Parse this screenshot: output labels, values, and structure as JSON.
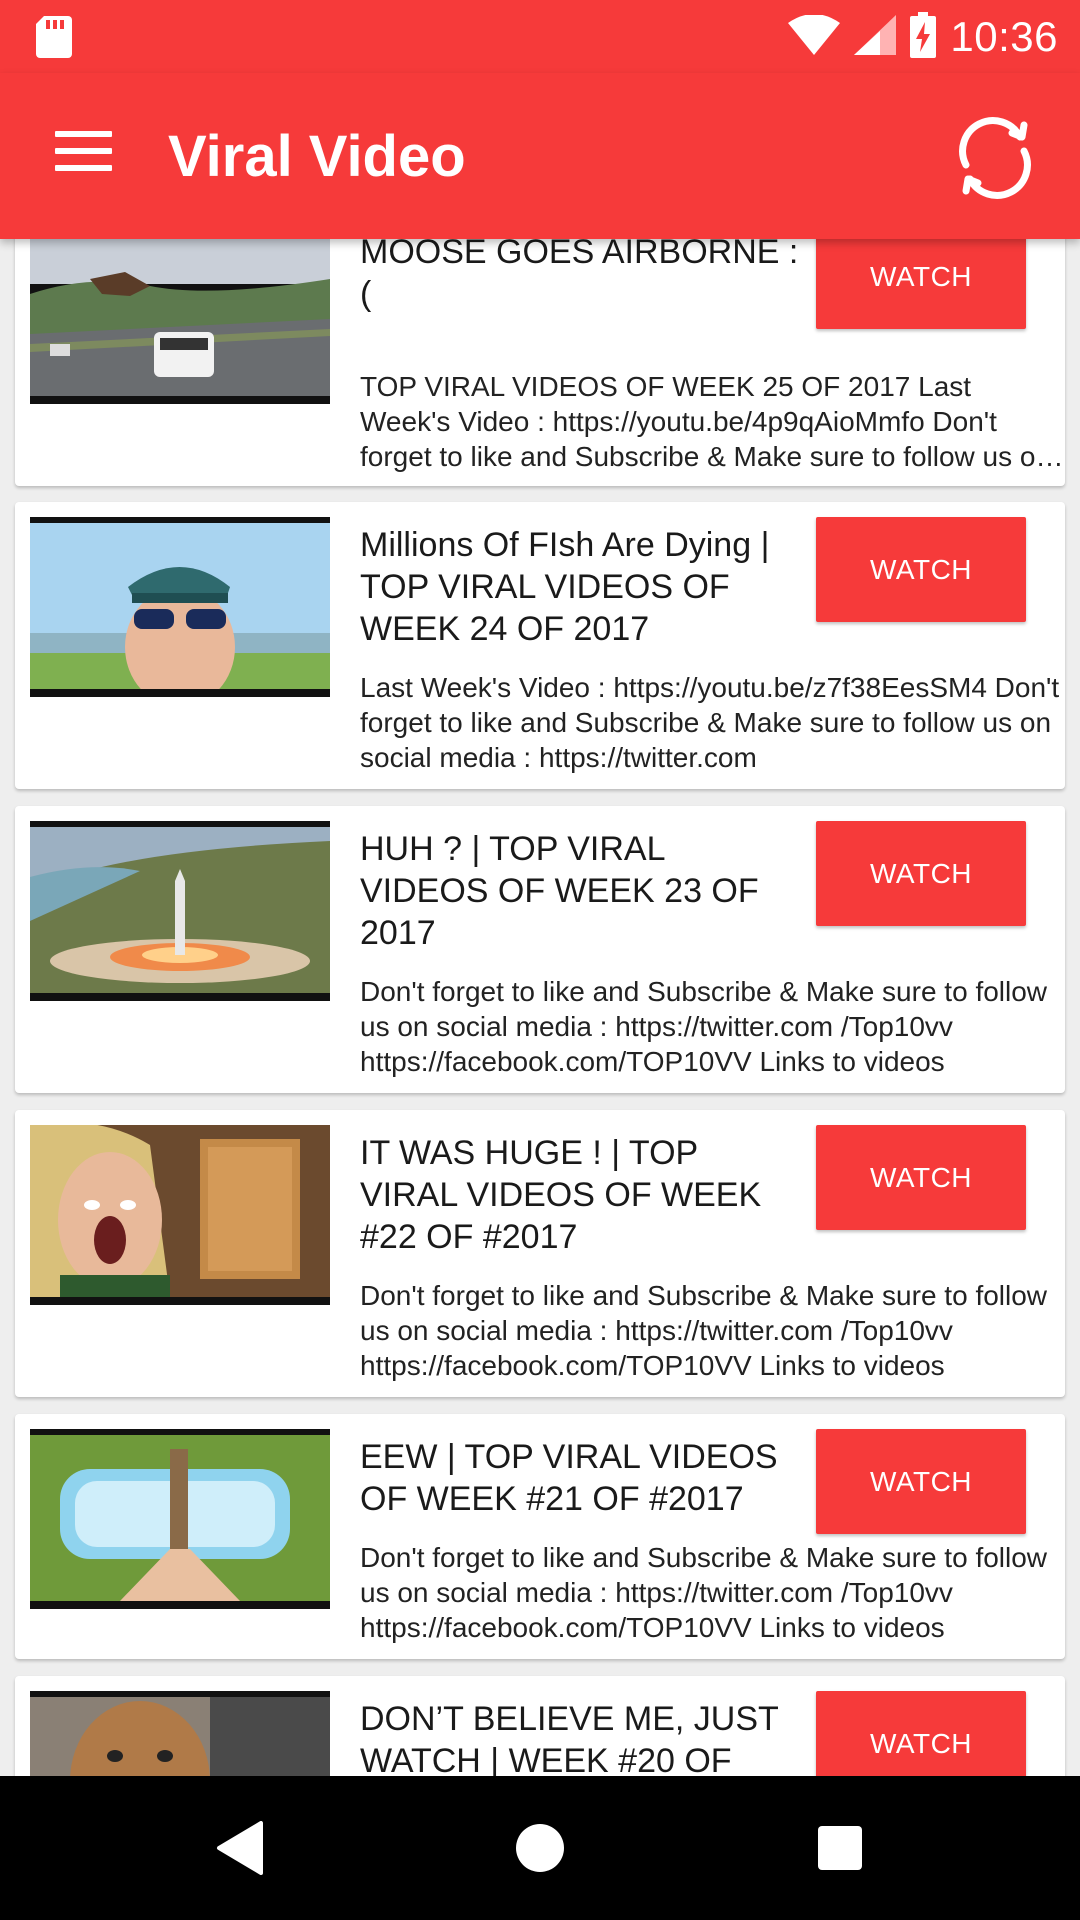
{
  "status_bar": {
    "time": "10:36",
    "icons": [
      "sd-card-icon",
      "wifi-icon",
      "signal-icon",
      "battery-charging-icon"
    ]
  },
  "app_bar": {
    "title": "Viral Video",
    "menu_icon": "hamburger-menu-icon",
    "refresh_icon": "refresh-icon"
  },
  "videos": [
    {
      "title": "MOOSE GOES AIRBORNE : (",
      "description": "TOP VIRAL VIDEOS OF WEEK 25 OF 2017 Last Week's Video : https://youtu.be/4p9qAioMmfo Don't forget to like and Subscribe & Make sure to follow us on social media",
      "button": "WATCH"
    },
    {
      "title": "Millions Of FIsh Are Dying | TOP VIRAL VIDEOS OF WEEK 24 OF 2017",
      "description": "Last Week's Video : https://youtu.be/z7f38EesSM4 Don't forget to like and Subscribe & Make sure to follow us on social media : https://twitter.com",
      "button": "WATCH"
    },
    {
      "title": "HUH ?  | TOP VIRAL VIDEOS OF WEEK 23 OF 2017",
      "description": "Don't forget to like and Subscribe & Make sure to follow us on social media : https://twitter.com /Top10vv https://facebook.com/TOP10VV Links to videos",
      "button": "WATCH"
    },
    {
      "title": "IT WAS HUGE ! | TOP VIRAL VIDEOS OF WEEK #22 OF #2017",
      "description": "Don't forget to like and Subscribe & Make sure to follow us on social media : https://twitter.com /Top10vv https://facebook.com/TOP10VV Links to videos",
      "button": "WATCH"
    },
    {
      "title": "EEW | TOP VIRAL VIDEOS OF WEEK #21 OF #2017",
      "description": "Don't forget to like and Subscribe & Make sure to follow us on social media : https://twitter.com /Top10vv https://facebook.com/TOP10VV Links to videos",
      "button": "WATCH"
    },
    {
      "title": "DON’T BELIEVE ME, JUST WATCH | WEEK #20 OF",
      "description": "",
      "button": "WATCH"
    }
  ],
  "nav_bar": {
    "back_icon": "back-triangle-icon",
    "home_icon": "home-circle-icon",
    "recents_icon": "recents-square-icon"
  },
  "colors": {
    "primary": "#f63a3a",
    "background": "#eeeeee",
    "card": "#ffffff"
  }
}
